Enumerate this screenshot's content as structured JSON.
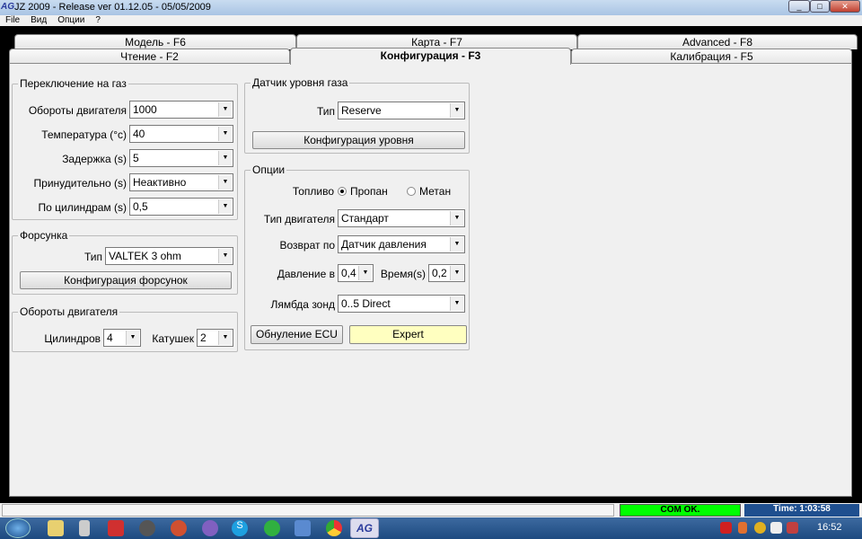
{
  "window": {
    "logo": "AG",
    "title": "JZ 2009  - Release  ver 01.12.05 - 05/05/2009"
  },
  "menu": [
    "File",
    "Вид",
    "Опции",
    "?"
  ],
  "tabs_row1": [
    "Модель - F6",
    "Карта - F7",
    "Advanced - F8"
  ],
  "tabs_row2": [
    "Чтение - F2",
    "Конфигурация - F3",
    "Калибрация - F5"
  ],
  "switch_group": {
    "title": "Переключение на газ",
    "rows": [
      {
        "label": "Обороты двигателя",
        "value": "1000"
      },
      {
        "label": "Температура (°c)",
        "value": "40"
      },
      {
        "label": "Задержка (s)",
        "value": "5"
      },
      {
        "label": "Принудительно (s)",
        "value": "Неактивно"
      },
      {
        "label": "По цилиндрам (s)",
        "value": "0,5"
      }
    ]
  },
  "injector_group": {
    "title": "Форсунка",
    "type_label": "Тип",
    "type_value": "VALTEK 3 ohm",
    "button": "Конфигурация форсунок"
  },
  "rpm_group": {
    "title": "Обороты двигателя",
    "cyl_label": "Цилиндров",
    "cyl_value": "4",
    "coil_label": "Катушек",
    "coil_value": "2"
  },
  "level_group": {
    "title": "Датчик уровня газа",
    "type_label": "Тип",
    "type_value": "Reserve",
    "button": "Конфигурация уровня"
  },
  "options_group": {
    "title": "Опции",
    "fuel_label": "Топливо",
    "fuel_options": [
      "Пропан",
      "Метан"
    ],
    "fuel_selected": "Пропан",
    "engine_label": "Тип двигателя",
    "engine_value": "Стандарт",
    "return_label": "Возврат по",
    "return_value": "Датчик давления",
    "pressure_label": "Давление в",
    "pressure_value": "0,4",
    "time_label": "Время(s)",
    "time_value": "0,2",
    "lambda_label": "Лямбда зонд",
    "lambda_value": "0..5 Direct",
    "reset_button": "Обнуление ECU",
    "expert_button": "Expert",
    "expert_color": "#ffffc0"
  },
  "status": {
    "com": "COM OK.",
    "com_color": "#00ff00",
    "time": "Time: 1:03:58",
    "time_color": "#1f4f8f"
  },
  "taskbar": {
    "clock": "16:52",
    "active_app": "AG"
  }
}
